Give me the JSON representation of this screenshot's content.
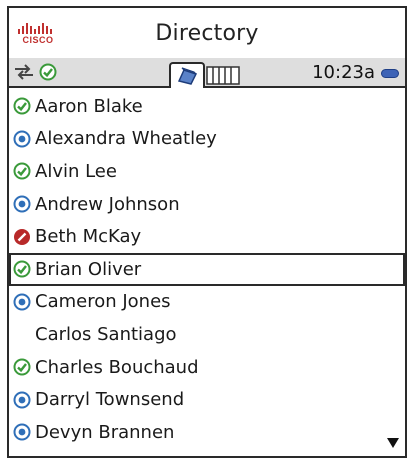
{
  "header": {
    "logo_text": "CISCO",
    "title": "Directory"
  },
  "status_bar": {
    "clock": "10:23a",
    "icons": [
      "sync-arrows-icon",
      "available-status-icon",
      "battery-icon"
    ]
  },
  "tabs": [
    {
      "icon": "contacts-book-icon",
      "active": true
    },
    {
      "icon": "keypad-columns-icon",
      "active": false
    }
  ],
  "contacts": [
    {
      "name": "Aaron Blake",
      "status": "available"
    },
    {
      "name": "Alexandra Wheatley",
      "status": "away"
    },
    {
      "name": "Alvin Lee",
      "status": "available"
    },
    {
      "name": "Andrew Johnson",
      "status": "away"
    },
    {
      "name": "Beth McKay",
      "status": "busy"
    },
    {
      "name": "Brian Oliver",
      "status": "available",
      "selected": true
    },
    {
      "name": "Cameron Jones",
      "status": "away"
    },
    {
      "name": "Carlos Santiago",
      "status": "none"
    },
    {
      "name": "Charles Bouchaud",
      "status": "available"
    },
    {
      "name": "Darryl Townsend",
      "status": "away"
    },
    {
      "name": "Devyn Brannen",
      "status": "away"
    }
  ],
  "colors": {
    "available": "#3a9a3a",
    "away": "#2f6fb8",
    "busy": "#b82a2a",
    "brand": "#c0302f",
    "battery": "#3d63b6"
  }
}
